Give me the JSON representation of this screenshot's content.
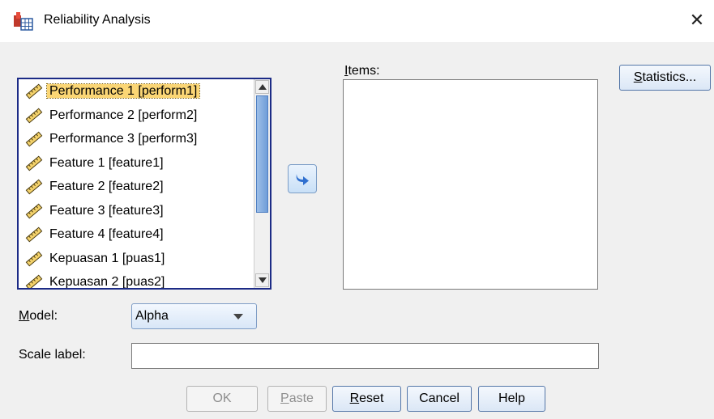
{
  "window": {
    "title": "Reliability Analysis",
    "close_glyph": "✕",
    "icon": "reliability-analysis-icon"
  },
  "variables": {
    "items": [
      {
        "label": "Performance 1 [perform1]",
        "selected": true
      },
      {
        "label": "Performance 2 [perform2]",
        "selected": false
      },
      {
        "label": "Performance 3 [perform3]",
        "selected": false
      },
      {
        "label": "Feature 1 [feature1]",
        "selected": false
      },
      {
        "label": "Feature 2 [feature2]",
        "selected": false
      },
      {
        "label": "Feature 3 [feature3]",
        "selected": false
      },
      {
        "label": "Feature 4 [feature4]",
        "selected": false
      },
      {
        "label": "Kepuasan 1 [puas1]",
        "selected": false
      },
      {
        "label": "Kepuasan 2 [puas2]",
        "selected": false
      }
    ],
    "item_icon": "scale-ruler-icon"
  },
  "items_panel": {
    "label_mnemonic": "I",
    "label_rest": "tems:"
  },
  "buttons": {
    "statistics": {
      "mnemonic": "S",
      "rest": "tatistics..."
    },
    "ok": "OK",
    "paste": {
      "mnemonic": "P",
      "rest": "aste"
    },
    "reset": {
      "mnemonic": "R",
      "rest": "eset"
    },
    "cancel": "Cancel",
    "help": "Help"
  },
  "model": {
    "label_mnemonic": "M",
    "label_rest": "odel:",
    "value": "Alpha"
  },
  "scale_label": {
    "label": "Scale label:",
    "value": ""
  },
  "colors": {
    "selection": "#fbd675",
    "list_border": "#1c2b86",
    "button_border": "#5476a8"
  }
}
